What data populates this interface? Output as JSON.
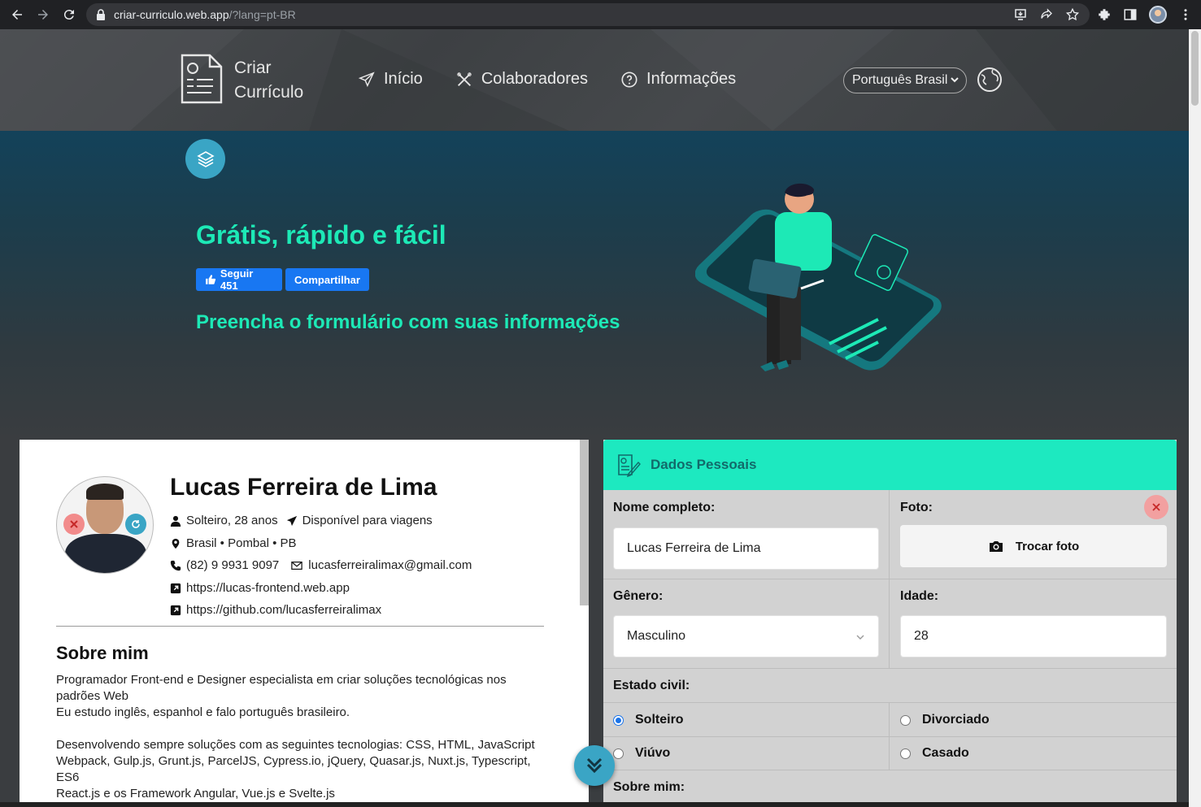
{
  "browser": {
    "url_host": "criar-curriculo.web.app",
    "url_query": "/?lang=pt-BR"
  },
  "header": {
    "brand_line1": "Criar",
    "brand_line2": "Currículo",
    "menu": [
      {
        "label": "Início",
        "icon": "paper-plane-icon"
      },
      {
        "label": "Colaboradores",
        "icon": "tools-icon"
      },
      {
        "label": "Informações",
        "icon": "question-circle-icon"
      }
    ],
    "language_selected": "Português Brasil"
  },
  "hero": {
    "title": "Grátis, rápido e fácil",
    "follow_label": "Seguir 451",
    "share_label": "Compartilhar",
    "subtitle": "Preencha o formulário com suas informações"
  },
  "resume": {
    "name": "Lucas Ferreira de Lima",
    "status": "Solteiro, 28 anos",
    "travel": "Disponível para viagens",
    "location": "Brasil • Pombal • PB",
    "phone": "(82) 9 9931 9097",
    "email": "lucasferreiralimax@gmail.com",
    "site": "https://lucas-frontend.web.app",
    "github": "https://github.com/lucasferreiralimax",
    "about_title": "Sobre mim",
    "about_p1_l1": "Programador Front-end e Designer especialista em criar soluções tecnológicas nos",
    "about_p1_l2": "padrões Web",
    "about_p1_l3": "Eu estudo inglês, espanhol e falo português brasileiro.",
    "about_p2_l1": "Desenvolvendo sempre soluções com as seguintes tecnologias: CSS, HTML, JavaScript",
    "about_p2_l2": "Webpack, Gulp.js, Grunt.js, ParcelJS, Cypress.io, jQuery, Quasar.js, Nuxt.js, Typescript,",
    "about_p2_l3": "ES6",
    "about_p2_l4": "React.js e os Framework Angular, Vue.js e Svelte.js"
  },
  "form": {
    "section_title": "Dados Pessoais",
    "name_label": "Nome completo:",
    "name_value": "Lucas Ferreira de Lima",
    "photo_label": "Foto:",
    "photo_button": "Trocar foto",
    "gender_label": "Gênero:",
    "gender_value": "Masculino",
    "age_label": "Idade:",
    "age_value": "28",
    "civil_label": "Estado civil:",
    "civil_options": [
      "Solteiro",
      "Divorciado",
      "Viúvo",
      "Casado"
    ],
    "civil_selected": "Solteiro",
    "about_label": "Sobre mim:"
  },
  "colors": {
    "accent": "#1de9b6",
    "badge_blue": "#3aa5c5",
    "facebook": "#1877f2"
  }
}
